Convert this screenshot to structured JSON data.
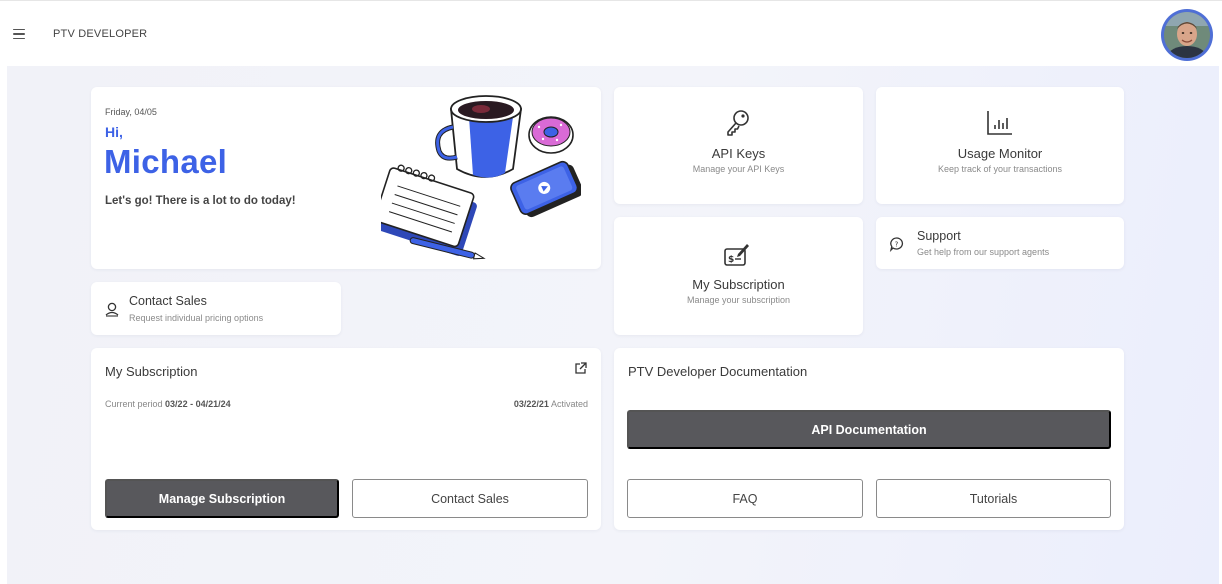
{
  "header": {
    "brand": "PTV DEVELOPER"
  },
  "greeting": {
    "date": "Friday, 04/05",
    "hi": "Hi,",
    "name": "Michael",
    "subtitle": "Let's go! There is a lot to do today!"
  },
  "tiles": {
    "api_keys": {
      "title": "API Keys",
      "subtitle": "Manage your API Keys",
      "icon": "key-icon"
    },
    "usage_monitor": {
      "title": "Usage Monitor",
      "subtitle": "Keep track of your transactions",
      "icon": "bar-chart-icon"
    },
    "my_subscription": {
      "title": "My Subscription",
      "subtitle": "Manage your subscription",
      "icon": "subscription-check-icon"
    },
    "support": {
      "title": "Support",
      "subtitle": "Get help from our support agents",
      "icon": "chat-help-icon"
    },
    "contact_sales": {
      "title": "Contact Sales",
      "subtitle": "Request individual pricing options",
      "icon": "person-icon"
    }
  },
  "subscription_card": {
    "title": "My Subscription",
    "period_label": "Current period",
    "period_value": "03/22 - 04/21/24",
    "activated_date": "03/22/21",
    "activated_label": "Activated",
    "manage_button": "Manage Subscription",
    "contact_button": "Contact Sales"
  },
  "docs_card": {
    "title": "PTV Developer Documentation",
    "api_docs_button": "API Documentation",
    "faq_button": "FAQ",
    "tutorials_button": "Tutorials"
  },
  "colors": {
    "accent": "#3d62e6",
    "dark_button": "#58585c",
    "avatar_ring": "#4f6fd6"
  }
}
